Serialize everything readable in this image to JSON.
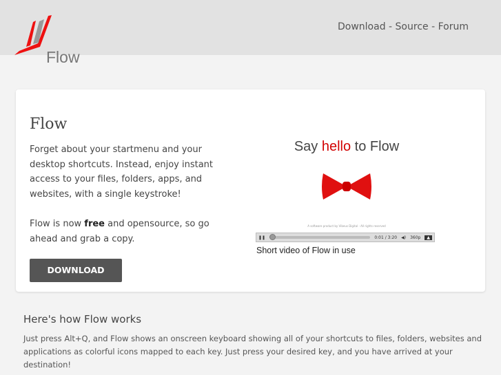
{
  "header": {
    "logo_text": "Flow",
    "nav": [
      "Download",
      "Source",
      "Forum"
    ],
    "separator": " - "
  },
  "card": {
    "title": "Flow",
    "para1": "Forget about your startmenu and your desktop shortcuts. Instead, enjoy instant access to your files, folders, apps, and websites, with a single keystroke!",
    "para2_pre": "Flow is now ",
    "para2_bold": "free",
    "para2_post": " and opensource, so go ahead and grab a copy.",
    "download_label": "DOWNLOAD"
  },
  "video": {
    "title_pre": "Say ",
    "title_highlight": "hello",
    "title_post": " to Flow",
    "credit": "A software product by Vibeus Digital - All rights reserved",
    "time": "0:01 / 3:20",
    "quality": "360p",
    "caption": "Short video of Flow in use"
  },
  "how": {
    "title": "Here's how Flow works",
    "text": "Just press Alt+Q, and Flow shows an onscreen keyboard showing all of your shortcuts to files, folders, websites and applications as colorful icons mapped to each key. Just press your desired key, and you have arrived at your destination!"
  }
}
